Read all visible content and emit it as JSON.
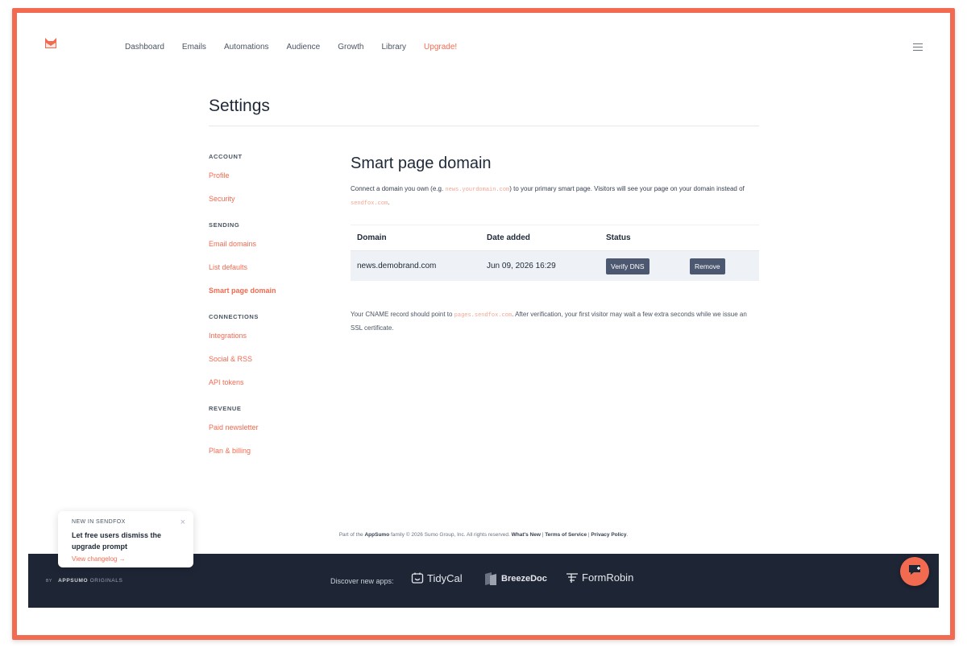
{
  "nav": {
    "items": [
      "Dashboard",
      "Emails",
      "Automations",
      "Audience",
      "Growth",
      "Library"
    ],
    "upgrade": "Upgrade!"
  },
  "settings": {
    "title": "Settings"
  },
  "sidebar": {
    "sections": [
      {
        "heading": "ACCOUNT",
        "items": [
          "Profile",
          "Security"
        ]
      },
      {
        "heading": "SENDING",
        "items": [
          "Email domains",
          "List defaults",
          "Smart page domain"
        ]
      },
      {
        "heading": "CONNECTIONS",
        "items": [
          "Integrations",
          "Social & RSS",
          "API tokens"
        ]
      },
      {
        "heading": "REVENUE",
        "items": [
          "Paid newsletter",
          "Plan & billing"
        ]
      }
    ],
    "active": "Smart page domain"
  },
  "main": {
    "title": "Smart page domain",
    "desc_1": "Connect a domain you own (e.g. ",
    "desc_example": "news.yourdomain.com",
    "desc_2": ") to your primary smart page. Visitors will see your page on your domain instead of ",
    "desc_default": "sendfox.com",
    "desc_3": ".",
    "table": {
      "headers": [
        "Domain",
        "Date added",
        "Status"
      ],
      "row": {
        "domain": "news.demobrand.com",
        "date": "Jun 09, 2026 16:29",
        "verify": "Verify DNS",
        "remove": "Remove"
      }
    },
    "note_1": "Your CNAME record should point to ",
    "note_target": "pages.sendfox.com",
    "note_2": ". After verification, your first visitor may wait a few extra seconds while we issue an SSL certificate."
  },
  "footer": {
    "part_of": "Part of the ",
    "appsumo": "AppSumo",
    "family": " family © 2026 Sumo Group, Inc. All rights reserved. ",
    "whats_new": "What's New",
    "sep": " | ",
    "tos": "Terms of Service",
    "privacy": "Privacy Policy",
    "end": ".",
    "brand_by": "BY",
    "brand_name": "APPSUMO",
    "brand_originals": "ORIGINALS",
    "discover": "Discover new apps:",
    "apps": [
      "TidyCal",
      "BreezeDoc",
      "FormRobin"
    ]
  },
  "toast": {
    "kicker": "NEW IN SENDFOX",
    "title": "Let free users dismiss the upgrade prompt",
    "link": "View changelog →",
    "close": "×"
  },
  "colors": {
    "accent": "#f26a50",
    "dark_footer": "#1e2535",
    "button": "#4b5870"
  }
}
